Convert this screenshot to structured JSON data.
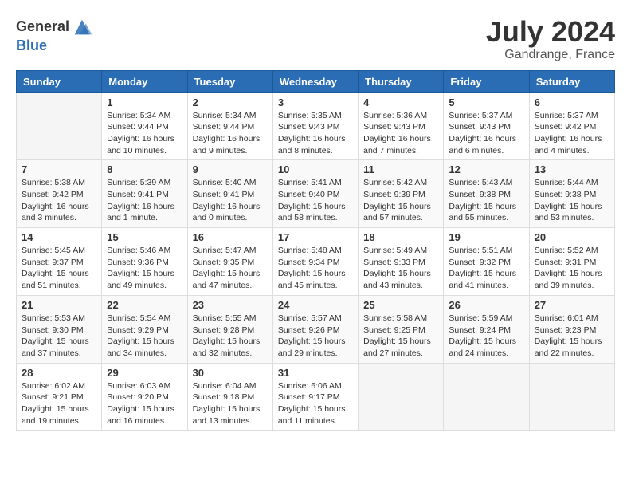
{
  "header": {
    "logo_general": "General",
    "logo_blue": "Blue",
    "month": "July 2024",
    "location": "Gandrange, France"
  },
  "days_of_week": [
    "Sunday",
    "Monday",
    "Tuesday",
    "Wednesday",
    "Thursday",
    "Friday",
    "Saturday"
  ],
  "weeks": [
    [
      {
        "day": "",
        "info": ""
      },
      {
        "day": "1",
        "info": "Sunrise: 5:34 AM\nSunset: 9:44 PM\nDaylight: 16 hours\nand 10 minutes."
      },
      {
        "day": "2",
        "info": "Sunrise: 5:34 AM\nSunset: 9:44 PM\nDaylight: 16 hours\nand 9 minutes."
      },
      {
        "day": "3",
        "info": "Sunrise: 5:35 AM\nSunset: 9:43 PM\nDaylight: 16 hours\nand 8 minutes."
      },
      {
        "day": "4",
        "info": "Sunrise: 5:36 AM\nSunset: 9:43 PM\nDaylight: 16 hours\nand 7 minutes."
      },
      {
        "day": "5",
        "info": "Sunrise: 5:37 AM\nSunset: 9:43 PM\nDaylight: 16 hours\nand 6 minutes."
      },
      {
        "day": "6",
        "info": "Sunrise: 5:37 AM\nSunset: 9:42 PM\nDaylight: 16 hours\nand 4 minutes."
      }
    ],
    [
      {
        "day": "7",
        "info": "Sunrise: 5:38 AM\nSunset: 9:42 PM\nDaylight: 16 hours\nand 3 minutes."
      },
      {
        "day": "8",
        "info": "Sunrise: 5:39 AM\nSunset: 9:41 PM\nDaylight: 16 hours\nand 1 minute."
      },
      {
        "day": "9",
        "info": "Sunrise: 5:40 AM\nSunset: 9:41 PM\nDaylight: 16 hours\nand 0 minutes."
      },
      {
        "day": "10",
        "info": "Sunrise: 5:41 AM\nSunset: 9:40 PM\nDaylight: 15 hours\nand 58 minutes."
      },
      {
        "day": "11",
        "info": "Sunrise: 5:42 AM\nSunset: 9:39 PM\nDaylight: 15 hours\nand 57 minutes."
      },
      {
        "day": "12",
        "info": "Sunrise: 5:43 AM\nSunset: 9:38 PM\nDaylight: 15 hours\nand 55 minutes."
      },
      {
        "day": "13",
        "info": "Sunrise: 5:44 AM\nSunset: 9:38 PM\nDaylight: 15 hours\nand 53 minutes."
      }
    ],
    [
      {
        "day": "14",
        "info": "Sunrise: 5:45 AM\nSunset: 9:37 PM\nDaylight: 15 hours\nand 51 minutes."
      },
      {
        "day": "15",
        "info": "Sunrise: 5:46 AM\nSunset: 9:36 PM\nDaylight: 15 hours\nand 49 minutes."
      },
      {
        "day": "16",
        "info": "Sunrise: 5:47 AM\nSunset: 9:35 PM\nDaylight: 15 hours\nand 47 minutes."
      },
      {
        "day": "17",
        "info": "Sunrise: 5:48 AM\nSunset: 9:34 PM\nDaylight: 15 hours\nand 45 minutes."
      },
      {
        "day": "18",
        "info": "Sunrise: 5:49 AM\nSunset: 9:33 PM\nDaylight: 15 hours\nand 43 minutes."
      },
      {
        "day": "19",
        "info": "Sunrise: 5:51 AM\nSunset: 9:32 PM\nDaylight: 15 hours\nand 41 minutes."
      },
      {
        "day": "20",
        "info": "Sunrise: 5:52 AM\nSunset: 9:31 PM\nDaylight: 15 hours\nand 39 minutes."
      }
    ],
    [
      {
        "day": "21",
        "info": "Sunrise: 5:53 AM\nSunset: 9:30 PM\nDaylight: 15 hours\nand 37 minutes."
      },
      {
        "day": "22",
        "info": "Sunrise: 5:54 AM\nSunset: 9:29 PM\nDaylight: 15 hours\nand 34 minutes."
      },
      {
        "day": "23",
        "info": "Sunrise: 5:55 AM\nSunset: 9:28 PM\nDaylight: 15 hours\nand 32 minutes."
      },
      {
        "day": "24",
        "info": "Sunrise: 5:57 AM\nSunset: 9:26 PM\nDaylight: 15 hours\nand 29 minutes."
      },
      {
        "day": "25",
        "info": "Sunrise: 5:58 AM\nSunset: 9:25 PM\nDaylight: 15 hours\nand 27 minutes."
      },
      {
        "day": "26",
        "info": "Sunrise: 5:59 AM\nSunset: 9:24 PM\nDaylight: 15 hours\nand 24 minutes."
      },
      {
        "day": "27",
        "info": "Sunrise: 6:01 AM\nSunset: 9:23 PM\nDaylight: 15 hours\nand 22 minutes."
      }
    ],
    [
      {
        "day": "28",
        "info": "Sunrise: 6:02 AM\nSunset: 9:21 PM\nDaylight: 15 hours\nand 19 minutes."
      },
      {
        "day": "29",
        "info": "Sunrise: 6:03 AM\nSunset: 9:20 PM\nDaylight: 15 hours\nand 16 minutes."
      },
      {
        "day": "30",
        "info": "Sunrise: 6:04 AM\nSunset: 9:18 PM\nDaylight: 15 hours\nand 13 minutes."
      },
      {
        "day": "31",
        "info": "Sunrise: 6:06 AM\nSunset: 9:17 PM\nDaylight: 15 hours\nand 11 minutes."
      },
      {
        "day": "",
        "info": ""
      },
      {
        "day": "",
        "info": ""
      },
      {
        "day": "",
        "info": ""
      }
    ]
  ]
}
